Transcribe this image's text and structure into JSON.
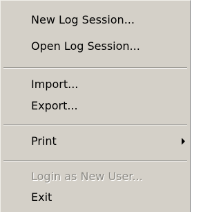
{
  "menu": {
    "new_log_session": "New Log Session...",
    "open_log_session": "Open Log Session...",
    "import": "Import...",
    "export": "Export...",
    "print": "Print",
    "login_as_new_user": "Login as New User...",
    "exit": "Exit",
    "print_submenu_icon": "submenu-arrow-icon",
    "disabled_items": [
      "Login as New User..."
    ]
  },
  "colors": {
    "menu_background": "#d4d0c8",
    "text": "#000000",
    "disabled_text": "#8c8a84"
  }
}
